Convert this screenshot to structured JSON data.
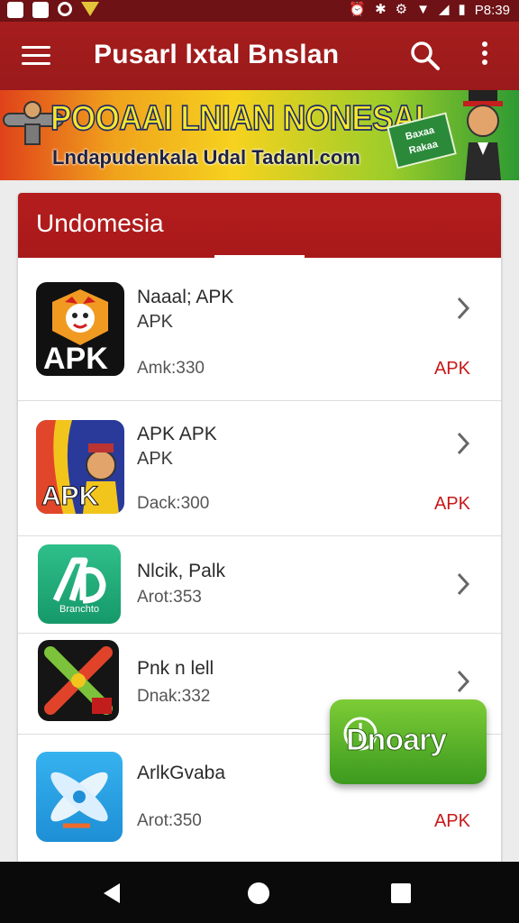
{
  "status_bar": {
    "left_icons": [
      "notification-icon",
      "gallery-icon",
      "record-icon",
      "warning-icon"
    ],
    "right_icons": [
      "alarm-icon",
      "bluetooth-icon",
      "settings-icon",
      "wifi-icon",
      "signal-icon",
      "battery-icon"
    ],
    "time": "P8:39"
  },
  "app_bar": {
    "title": "Pusarl lxtal Bnslan",
    "icons": [
      "menu-icon",
      "search-icon",
      "more-vert-icon"
    ]
  },
  "banner": {
    "headline": "POOAAI LNIAN NONESAI",
    "subline": "Lndapudenkala Udal Tadanl.com",
    "badge_text": "Baxaa Rakaa"
  },
  "card": {
    "title": "Undomesia",
    "items": [
      {
        "name": "Naaal; APK",
        "subtitle": "APK",
        "meta": "Amk:330",
        "tag": "APK",
        "icon": "apk-logo-icon",
        "icon_text": "APK"
      },
      {
        "name": "APK APK",
        "subtitle": "APK",
        "meta": "Dack:300",
        "tag": "APK",
        "icon": "apk-character-icon",
        "icon_text": "APK"
      },
      {
        "name": "Nlcik, Palk",
        "subtitle": "",
        "meta": "Arot:353",
        "tag": "",
        "icon": "green-app-icon",
        "icon_text": "Branchto"
      },
      {
        "name": "Pnk n lell",
        "subtitle": "",
        "meta": "Dnak:332",
        "tag": "",
        "icon": "crossed-tools-icon",
        "icon_text": ""
      },
      {
        "name": "ArlkGvaba",
        "subtitle": "",
        "meta": "Arot:350",
        "tag": "APK",
        "icon": "blue-tool-icon",
        "icon_text": ""
      }
    ]
  },
  "fab": {
    "label": "Dnoary",
    "icon": "download-icon"
  },
  "nav_bar": {
    "icons": [
      "back-icon",
      "home-icon",
      "recents-icon"
    ]
  },
  "colors": {
    "app_bar": "#a61d1d",
    "status_bar": "#6e1216",
    "accent_red": "#c81818",
    "fab_green": "#4aaa24"
  }
}
